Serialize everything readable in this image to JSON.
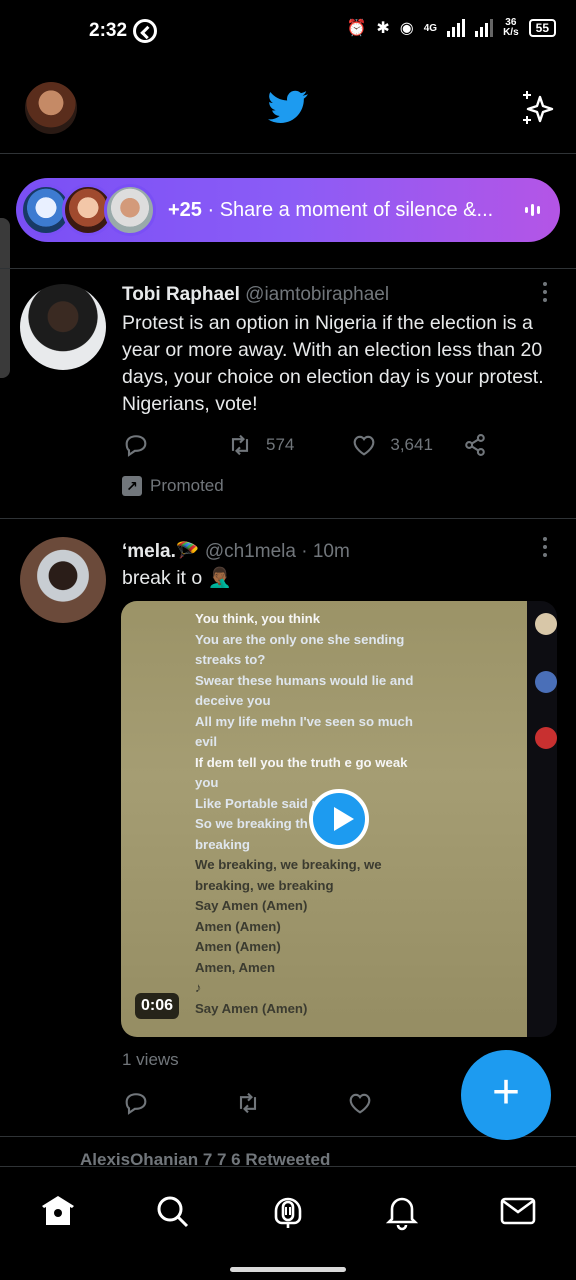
{
  "status_bar": {
    "time": "2:32",
    "network": "4G",
    "speed_value": "36",
    "speed_unit": "K/s",
    "battery": "55"
  },
  "header": {
    "logo_icon": "twitter-bird-icon",
    "sparkle_icon": "sparkle-icon"
  },
  "spaces": {
    "count": "+25",
    "title": "· Share a moment of silence &..."
  },
  "tweets": [
    {
      "name": "Tobi Raphael",
      "handle": "@iamtobiraphael",
      "time": "",
      "text": "Protest is an option in Nigeria if the election is a year or more away. With an election less than 20 days, your choice on election day is your protest. Nigerians, vote!",
      "retweets": "574",
      "likes": "3,641",
      "promoted_label": "Promoted"
    },
    {
      "name": "‘mela.",
      "name_emoji": "🪂",
      "handle": "@ch1mela",
      "time": "· 10m",
      "text": "break it o 🤦🏾‍♂️",
      "video_duration": "0:06",
      "views": "1 views"
    }
  ],
  "video_lyrics": [
    "You think, you think",
    "You are the only one she sending",
    "streaks to?",
    "Swear these humans would lie and",
    "deceive you",
    "All my life mehn I've seen so much",
    "evil",
    "If dem tell you the truth e go weak",
    "you",
    "Like Portable said               rip you\"",
    "So we breaking th              nd we",
    "breaking",
    "We breaking, we breaking, we",
    "breaking, we breaking",
    "Say Amen (Amen)",
    "Amen (Amen)",
    "Amen (Amen)",
    "Amen, Amen",
    "♪",
    "Say Amen (Amen)"
  ],
  "retweeted_row": {
    "text": "AlexisOhanian 7 7 6 Retweeted"
  },
  "fab": {
    "label": "+"
  },
  "colors": {
    "accent": "#1d9bf0",
    "spaces_gradient_start": "#7a4ff5",
    "spaces_gradient_end": "#b455e6",
    "secondary_text": "#71767b"
  }
}
